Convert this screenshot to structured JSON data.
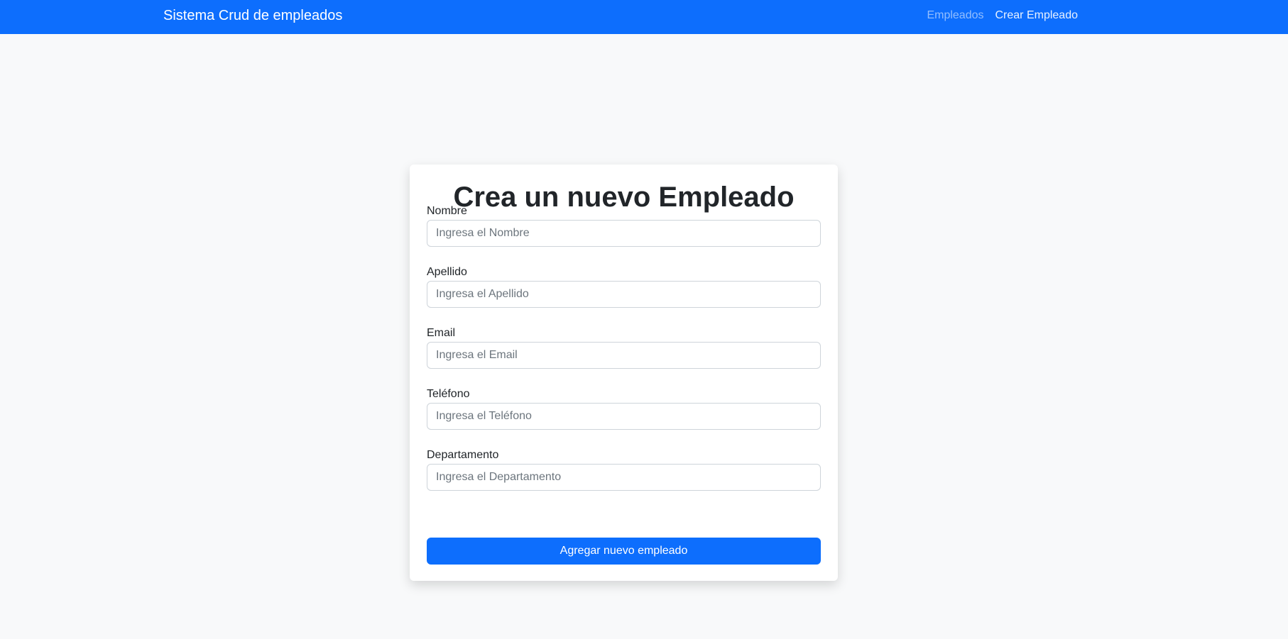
{
  "navbar": {
    "brand": "Sistema Crud de empleados",
    "links": [
      {
        "label": "Empleados"
      },
      {
        "label": "Crear Empleado"
      }
    ],
    "colors": {
      "background": "#0d6efd"
    }
  },
  "form": {
    "title": "Crea un nuevo Empleado",
    "fields": [
      {
        "label": "Nombre",
        "placeholder": "Ingresa el Nombre",
        "value": ""
      },
      {
        "label": "Apellido",
        "placeholder": "Ingresa el Apellido",
        "value": ""
      },
      {
        "label": "Email",
        "placeholder": "Ingresa el Email",
        "value": ""
      },
      {
        "label": "Teléfono",
        "placeholder": "Ingresa el Teléfono",
        "value": ""
      },
      {
        "label": "Departamento",
        "placeholder": "Ingresa el Departamento",
        "value": ""
      }
    ],
    "submit_label": "Agregar nuevo empleado",
    "colors": {
      "primary": "#0d6efd",
      "page_background": "#f8f9fa"
    }
  }
}
